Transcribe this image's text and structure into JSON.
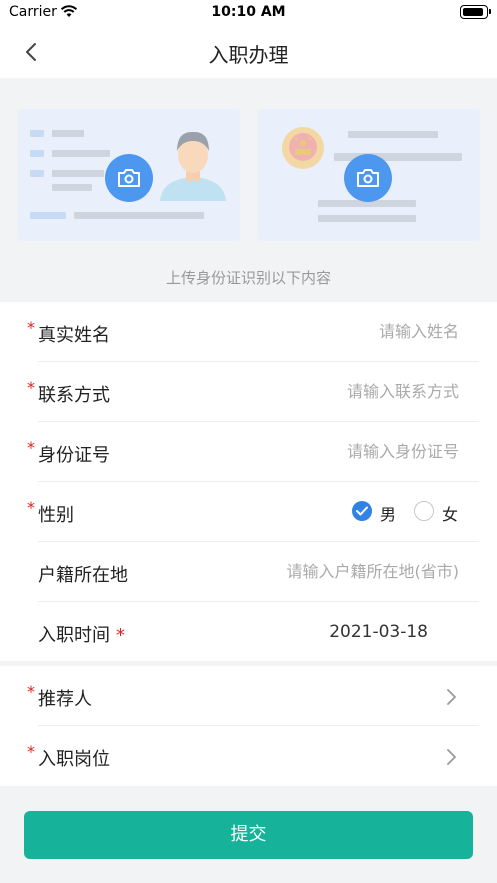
{
  "status_bar": {
    "carrier": "Carrier",
    "time": "10:10 AM"
  },
  "nav": {
    "title": "入职办理",
    "back_icon": "chevron-left-icon"
  },
  "upload": {
    "hint": "上传身份证识别以下内容",
    "card_front_icon": "camera-icon",
    "card_back_icon": "camera-icon"
  },
  "form": {
    "name": {
      "required": "*",
      "label": "真实姓名",
      "placeholder": "请输入姓名"
    },
    "contact": {
      "required": "*",
      "label": "联系方式",
      "placeholder": "请输入联系方式"
    },
    "id_number": {
      "required": "*",
      "label": "身份证号",
      "placeholder": "请输入身份证号"
    },
    "gender": {
      "required": "*",
      "label": "性别",
      "options": [
        "男",
        "女"
      ],
      "selected": "男"
    },
    "hukou": {
      "label": "户籍所在地",
      "placeholder": "请输入户籍所在地(省市)"
    },
    "entry_date": {
      "label": "入职时间",
      "required": "*",
      "value": "2021-03-18"
    },
    "referrer": {
      "required": "*",
      "label": "推荐人"
    },
    "position": {
      "required": "*",
      "label": "入职岗位"
    }
  },
  "submit": {
    "label": "提交"
  },
  "colors": {
    "accent": "#16b29a",
    "radio_on": "#2f83e6",
    "camera": "#4d97ee",
    "required": "#e02020"
  }
}
